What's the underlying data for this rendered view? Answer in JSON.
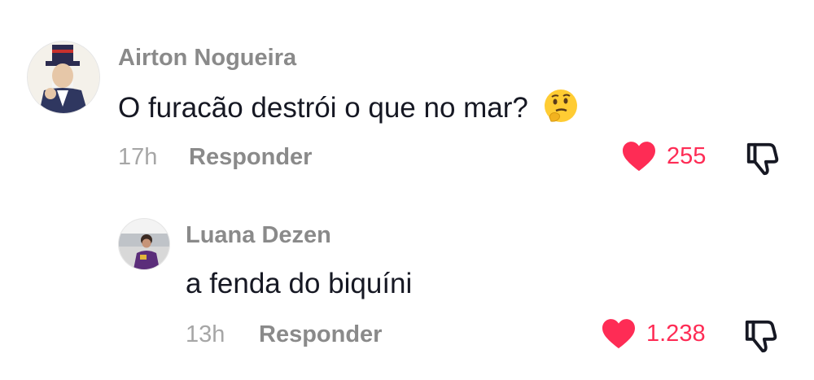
{
  "comments": [
    {
      "author": "Airton Nogueira",
      "text": "O furacão destrói o que no mar?",
      "emoji": "thinking-face",
      "time": "17h",
      "reply_label": "Responder",
      "like_count": "255",
      "avatar": "uncle-sam-avatar"
    },
    {
      "author": "Luana Dezen",
      "text": "a fenda do biquíni",
      "time": "13h",
      "reply_label": "Responder",
      "like_count": "1.238",
      "avatar": "user-photo-avatar"
    }
  ],
  "colors": {
    "like": "#fe2c55",
    "name": "#8a8a8a",
    "text": "#161823",
    "meta": "#a6a6a6"
  },
  "icons": [
    "heart-icon",
    "thumbs-down-icon",
    "thinking-emoji"
  ]
}
